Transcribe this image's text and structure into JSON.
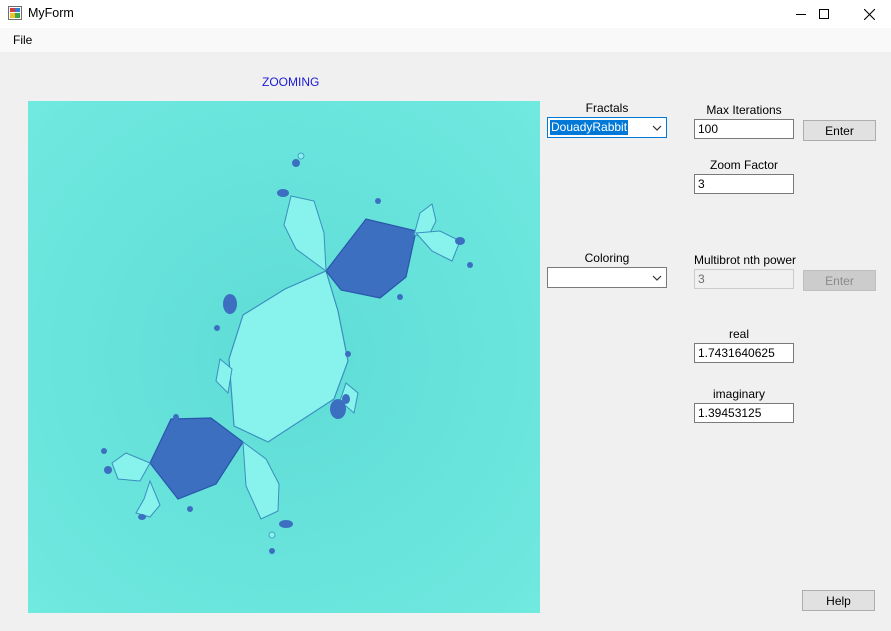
{
  "window": {
    "title": "MyForm",
    "icon": "app-icon",
    "controls": {
      "minimize_icon": "minimize-icon",
      "maximize_icon": "maximize-icon",
      "close_icon": "close-icon"
    }
  },
  "menu": {
    "items": [
      "File"
    ]
  },
  "status": {
    "text": "ZOOMING",
    "color": "#1a1ad6"
  },
  "fractal": {
    "name": "Douady Rabbit",
    "colors": {
      "background": "#6be6dd",
      "body": "#88f2ec",
      "core": "#3c6fc0",
      "edge": "#2a56ad"
    }
  },
  "controls": {
    "fractals": {
      "label": "Fractals",
      "selected": "DouadyRabbit"
    },
    "coloring": {
      "label": "Coloring",
      "selected": ""
    },
    "max_iterations": {
      "label": "Max Iterations",
      "value": "100"
    },
    "enter_button": {
      "label": "Enter"
    },
    "zoom_factor": {
      "label": "Zoom Factor",
      "value": "3"
    },
    "multibrot": {
      "label": "Multibrot nth power",
      "value": "3",
      "enabled": false
    },
    "enter_button_2": {
      "label": "Enter",
      "enabled": false
    },
    "real": {
      "label": "real",
      "value": "1.7431640625"
    },
    "imaginary": {
      "label": "imaginary",
      "value": "1.39453125"
    },
    "help_button": {
      "label": "Help"
    }
  }
}
